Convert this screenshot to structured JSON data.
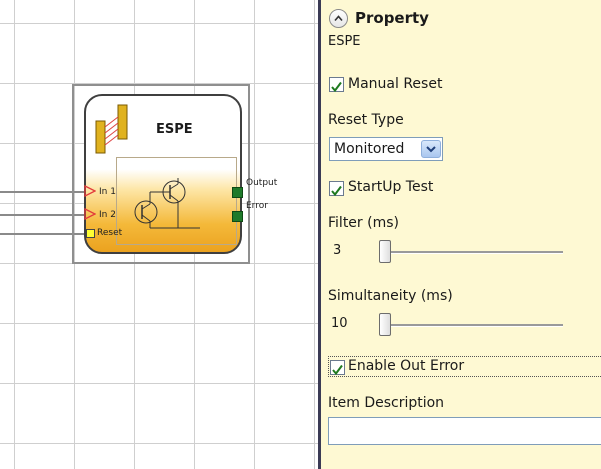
{
  "canvas": {
    "block": {
      "title": "ESPE",
      "inputs": [
        {
          "label": "In 1"
        },
        {
          "label": "In 2"
        },
        {
          "label": "Reset"
        }
      ],
      "outputs": [
        {
          "label": "Output"
        },
        {
          "label": "Error"
        }
      ]
    },
    "colors": {
      "block_top": "#ffffff",
      "block_bottom": "#eba21f",
      "output_pin": "#1e7a2a",
      "input_arrow": "#e23b3b",
      "reset_pin": "#ffff33",
      "grid": "#cfcfcf"
    }
  },
  "panel": {
    "title": "Property",
    "collapse_icon": "chevron-up-icon",
    "element_name": "ESPE",
    "manual_reset": {
      "label": "Manual Reset",
      "checked": true
    },
    "reset_type": {
      "label": "Reset Type",
      "value": "Monitored"
    },
    "startup_test": {
      "label": "StartUp Test",
      "checked": true
    },
    "filter": {
      "label": "Filter (ms)",
      "value": "3"
    },
    "simultaneity": {
      "label": "Simultaneity (ms)",
      "value": "10"
    },
    "enable_out_error": {
      "label": "Enable Out Error",
      "checked": true
    },
    "item_description": {
      "label": "Item Description",
      "value": ""
    },
    "background": "#fef9d3"
  }
}
